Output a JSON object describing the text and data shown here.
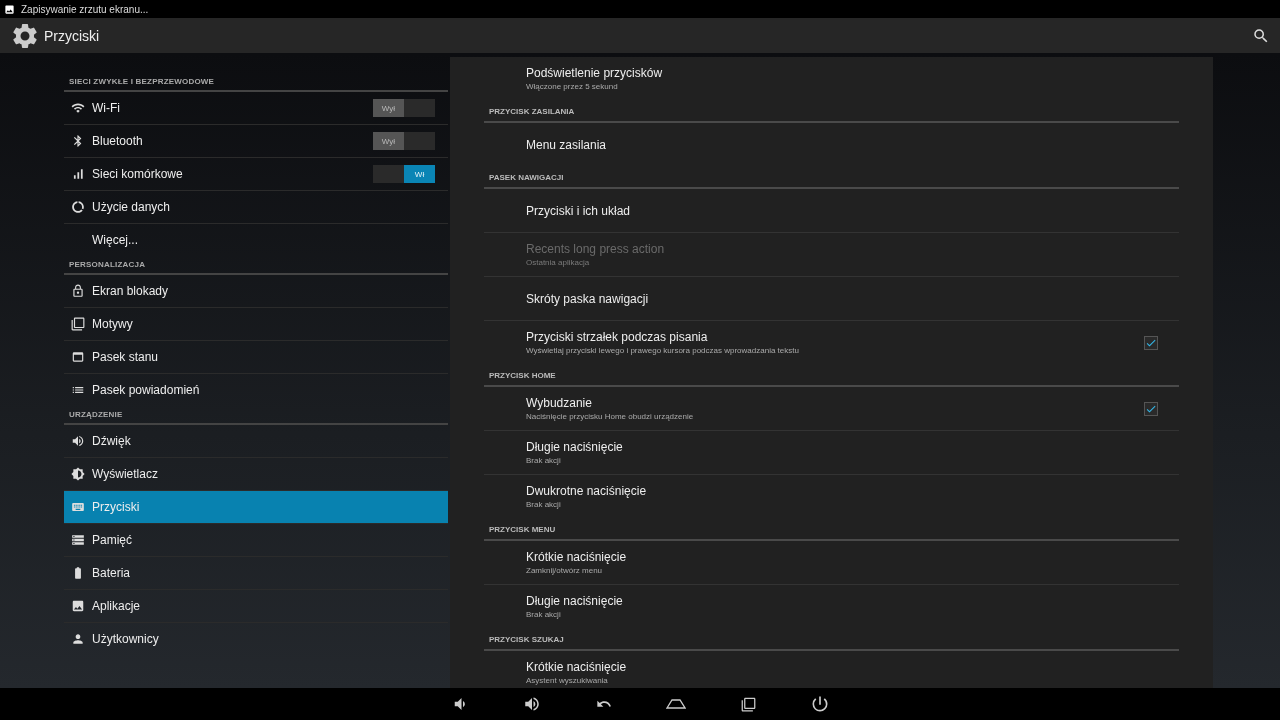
{
  "status_bar": {
    "notification": "Zapisywanie zrzutu ekranu..."
  },
  "action_bar": {
    "title": "Przyciski"
  },
  "sidebar": {
    "sections": [
      {
        "header": "SIECI ZWYKŁE I BEZPRZEWODOWE",
        "items": [
          {
            "label": "Wi-Fi",
            "kind": "toggle",
            "selected": false,
            "toggle": {
              "label": "Wył",
              "on": false
            }
          },
          {
            "label": "Bluetooth",
            "kind": "toggle",
            "selected": false,
            "toggle": {
              "label": "Wył",
              "on": false
            }
          },
          {
            "label": "Sieci komórkowe",
            "kind": "toggle",
            "selected": false,
            "toggle": {
              "label": "Wł",
              "on": true
            }
          },
          {
            "label": "Użycie danych",
            "kind": "link",
            "selected": false
          },
          {
            "label": "Więcej...",
            "kind": "link",
            "selected": false
          }
        ]
      },
      {
        "header": "PERSONALIZACJA",
        "items": [
          {
            "label": "Ekran blokady",
            "kind": "link",
            "selected": false
          },
          {
            "label": "Motywy",
            "kind": "link",
            "selected": false
          },
          {
            "label": "Pasek stanu",
            "kind": "link",
            "selected": false
          },
          {
            "label": "Pasek powiadomień",
            "kind": "link",
            "selected": false
          }
        ]
      },
      {
        "header": "URZĄDZENIE",
        "items": [
          {
            "label": "Dźwięk",
            "kind": "link",
            "selected": false
          },
          {
            "label": "Wyświetlacz",
            "kind": "link",
            "selected": false
          },
          {
            "label": "Przyciski",
            "kind": "link",
            "selected": true
          },
          {
            "label": "Pamięć",
            "kind": "link",
            "selected": false
          },
          {
            "label": "Bateria",
            "kind": "link",
            "selected": false
          },
          {
            "label": "Aplikacje",
            "kind": "link",
            "selected": false
          },
          {
            "label": "Użytkownicy",
            "kind": "link",
            "selected": false
          }
        ]
      }
    ]
  },
  "detail": {
    "sections": [
      {
        "items": [
          {
            "title": "Podświetlenie przycisków",
            "summary": "Włączone przez 5 sekund",
            "kind": "plain",
            "disabled": false
          }
        ]
      },
      {
        "header": "PRZYCISK ZASILANIA",
        "items": [
          {
            "title": "Menu zasilania",
            "kind": "plain",
            "disabled": false
          }
        ]
      },
      {
        "header": "PASEK NAWIGACJI",
        "items": [
          {
            "title": "Przyciski i ich układ",
            "kind": "plain",
            "disabled": false
          },
          {
            "title": "Recents long press action",
            "summary": "Ostatnia aplikacja",
            "kind": "plain",
            "disabled": true
          },
          {
            "title": "Skróty paska nawigacji",
            "kind": "plain",
            "disabled": false
          },
          {
            "title": "Przyciski strzałek podczas pisania",
            "summary": "Wyświetlaj przyciski lewego i prawego kursora podczas wprowadzania tekstu",
            "kind": "checkbox",
            "checked": true,
            "disabled": false
          }
        ]
      },
      {
        "header": "PRZYCISK HOME",
        "items": [
          {
            "title": "Wybudzanie",
            "summary": "Naciśnięcie przycisku Home obudzi urządzenie",
            "kind": "checkbox",
            "checked": true,
            "disabled": false
          },
          {
            "title": "Długie naciśnięcie",
            "summary": "Brak akcji",
            "kind": "plain",
            "disabled": false
          },
          {
            "title": "Dwukrotne naciśnięcie",
            "summary": "Brak akcji",
            "kind": "plain",
            "disabled": false
          }
        ]
      },
      {
        "header": "PRZYCISK MENU",
        "items": [
          {
            "title": "Krótkie naciśnięcie",
            "summary": "Zamknij/otwórz menu",
            "kind": "plain",
            "disabled": false
          },
          {
            "title": "Długie naciśnięcie",
            "summary": "Brak akcji",
            "kind": "plain",
            "disabled": false
          }
        ]
      },
      {
        "header": "PRZYCISK SZUKAJ",
        "items": [
          {
            "title": "Krótkie naciśnięcie",
            "summary": "Asystent wyszukiwania",
            "kind": "plain",
            "disabled": false
          }
        ]
      }
    ]
  }
}
